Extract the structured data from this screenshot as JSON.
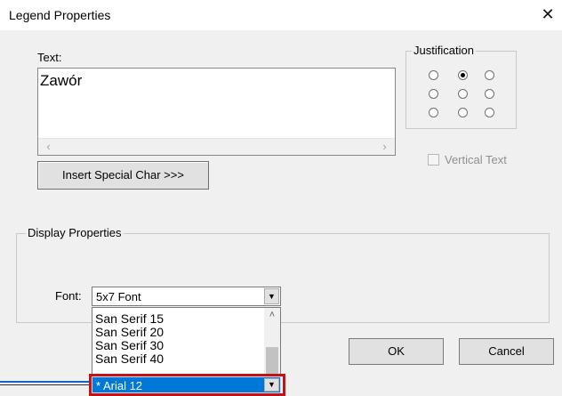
{
  "window": {
    "title": "Legend Properties",
    "close_glyph": "✕"
  },
  "text_group": {
    "label": "Text:",
    "value": "Zawór"
  },
  "scroll": {
    "left_arrow": "‹",
    "right_arrow": "›"
  },
  "insert_special_label": "Insert Special Char >>>",
  "justification": {
    "label": "Justification",
    "selected": [
      0,
      1
    ]
  },
  "vertical_text_label": "Vertical Text",
  "display_properties": {
    "label": "Display Properties"
  },
  "font": {
    "label": "Font:",
    "current": "5x7 Font",
    "options": [
      "San Serif 15",
      "San Serif 20",
      "San Serif 30",
      "San Serif 40"
    ],
    "selected_option": "* Arial 12"
  },
  "buttons": {
    "ok": "OK",
    "cancel": "Cancel"
  },
  "icons": {
    "dropdown": "chevron-down-icon",
    "scroll_up": "chevron-up-icon"
  },
  "colors": {
    "selection": "#0078d7",
    "highlight": "#c0141c"
  }
}
